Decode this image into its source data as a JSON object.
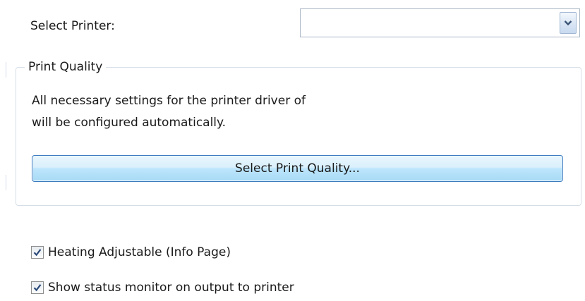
{
  "printer": {
    "label": "Select Printer:",
    "selected_value": ""
  },
  "print_quality": {
    "legend": "Print Quality",
    "description_line1": "All necessary settings for the printer driver of",
    "description_line2": "will be configured automatically.",
    "button_label": "Select Print Quality..."
  },
  "options": {
    "heating_label": "Heating Adjustable (Info Page)",
    "heating_checked": true,
    "status_monitor_label": "Show status monitor on output to printer",
    "status_monitor_checked": true
  },
  "icons": {
    "dropdown": "chevron-down-icon",
    "check": "checkmark-icon"
  },
  "colors": {
    "button_border": "#3d7bbf",
    "button_fill": "#bee6fd",
    "check_mark": "#2b4a7a"
  }
}
